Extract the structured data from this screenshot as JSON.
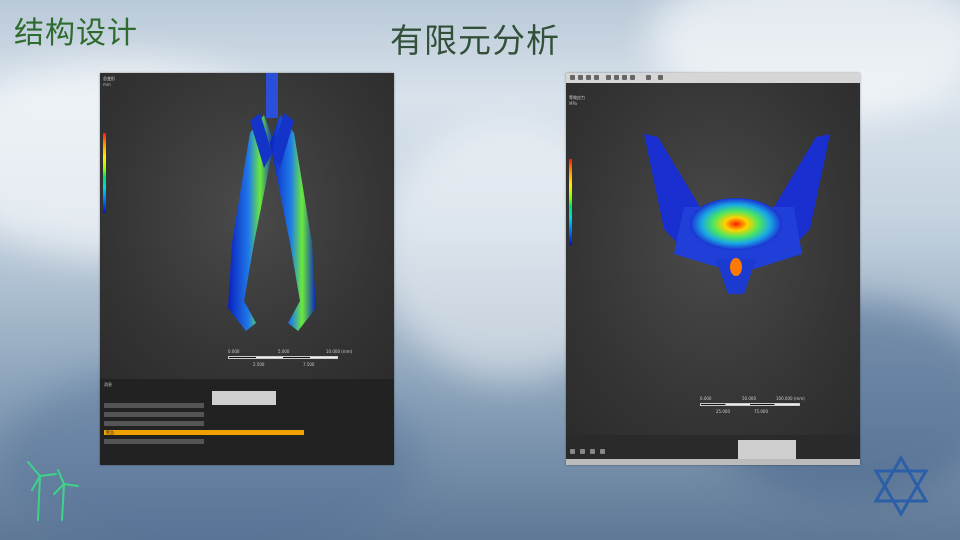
{
  "slide": {
    "corner_title": "结构设计",
    "main_title": "有限元分析"
  },
  "left_panel": {
    "legend_title": "总变形",
    "legend_unit": "mm",
    "scale_left": "0.000",
    "scale_mid": "5.000",
    "scale_right": "10.000 (mm)",
    "scale_lo1": "2.500",
    "scale_lo2": "7.500",
    "console_header": "消息",
    "highlight_line": "警告"
  },
  "right_panel": {
    "legend_title": "等效应力",
    "legend_unit": "MPa",
    "scale_left": "0.000",
    "scale_mid": "50.000",
    "scale_right": "100.000 (mm)",
    "scale_lo1": "25.000",
    "scale_lo2": "75.000"
  },
  "colors": {
    "corner_title": "#2f6b2e",
    "main_title": "#33503a",
    "turbine_icon": "#3fd38a",
    "star_icon": "#2c5fa8",
    "fea_blue": "#1a2fd0",
    "fea_red": "#ff2000"
  },
  "icons": [
    "wind-turbine-icon",
    "star-of-david-icon"
  ]
}
